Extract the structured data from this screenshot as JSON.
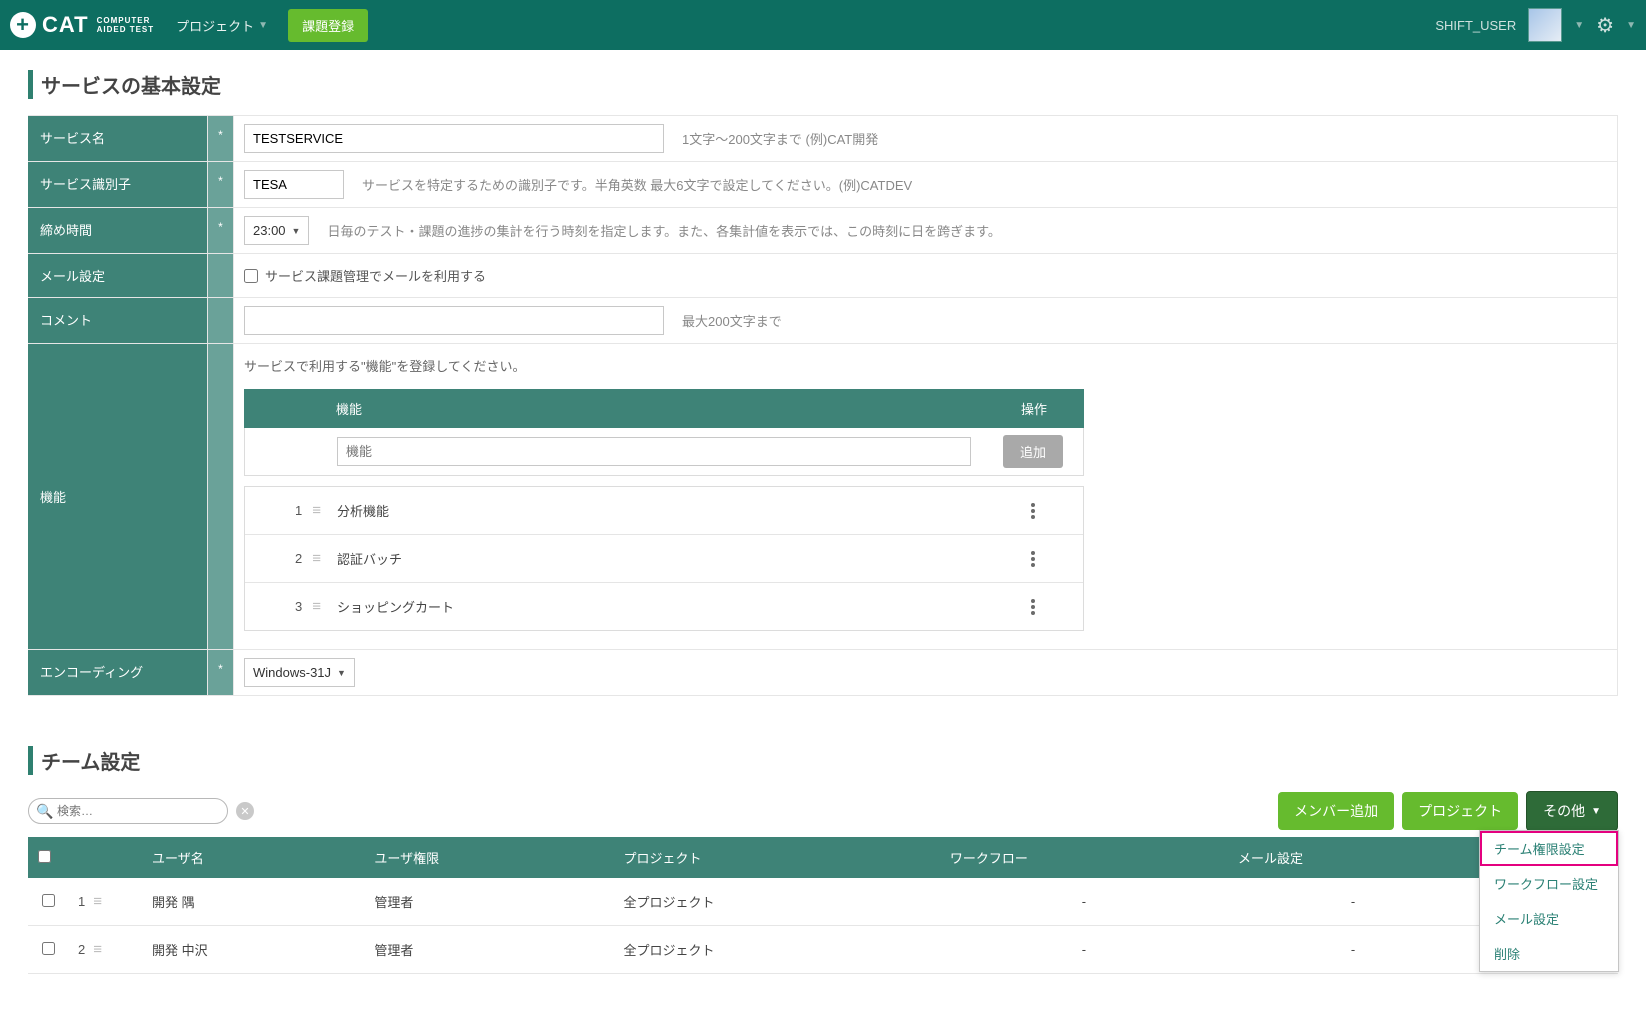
{
  "header": {
    "brand_main": "CAT",
    "brand_sub1": "COMPUTER",
    "brand_sub2": "AIDED TEST",
    "nav_project": "プロジェクト",
    "btn_issue": "課題登録",
    "username": "SHIFT_USER"
  },
  "basic": {
    "title": "サービスの基本設定",
    "req_mark": "*",
    "labels": {
      "service_name": "サービス名",
      "service_id": "サービス識別子",
      "deadline": "締め時間",
      "mail": "メール設定",
      "comment": "コメント",
      "feature": "機能",
      "encoding": "エンコーディング"
    },
    "values": {
      "service_name": "TESTSERVICE",
      "service_id": "TESA",
      "deadline": "23:00",
      "encoding": "Windows-31J",
      "comment": ""
    },
    "hints": {
      "service_name": "1文字～200文字まで (例)CAT開発",
      "service_id": "サービスを特定するための識別子です。半角英数 最大6文字で設定してください。(例)CATDEV",
      "deadline": "日毎のテスト・課題の進捗の集計を行う時刻を指定します。また、各集計値を表示では、この時刻に日を跨ぎます。",
      "comment": "最大200文字まで",
      "feature_intro": "サービスで利用する\"機能\"を登録してください。"
    },
    "mail_checkbox": "サービス課題管理でメールを利用する",
    "feature_table": {
      "col_feature": "機能",
      "col_op": "操作",
      "placeholder_feature": "機能",
      "btn_add": "追加"
    },
    "features": [
      {
        "idx": "1",
        "name": "分析機能"
      },
      {
        "idx": "2",
        "name": "認証バッチ"
      },
      {
        "idx": "3",
        "name": "ショッピングカート"
      }
    ]
  },
  "team": {
    "title": "チーム設定",
    "search_placeholder": "検索…",
    "btn_add_member": "メンバー追加",
    "btn_project": "プロジェクト",
    "btn_other": "その他",
    "dropdown": {
      "perm": "チーム権限設定",
      "workflow": "ワークフロー設定",
      "mail": "メール設定",
      "delete": "削除"
    },
    "columns": {
      "username": "ユーザ名",
      "role": "ユーザ権限",
      "project": "プロジェクト",
      "workflow": "ワークフロー",
      "mail": "メール設定"
    },
    "rows": [
      {
        "idx": "1",
        "name": "開発 隅",
        "role": "管理者",
        "project": "全プロジェクト",
        "workflow": "-",
        "mail": "-"
      },
      {
        "idx": "2",
        "name": "開発 中沢",
        "role": "管理者",
        "project": "全プロジェクト",
        "workflow": "-",
        "mail": "-"
      }
    ]
  }
}
